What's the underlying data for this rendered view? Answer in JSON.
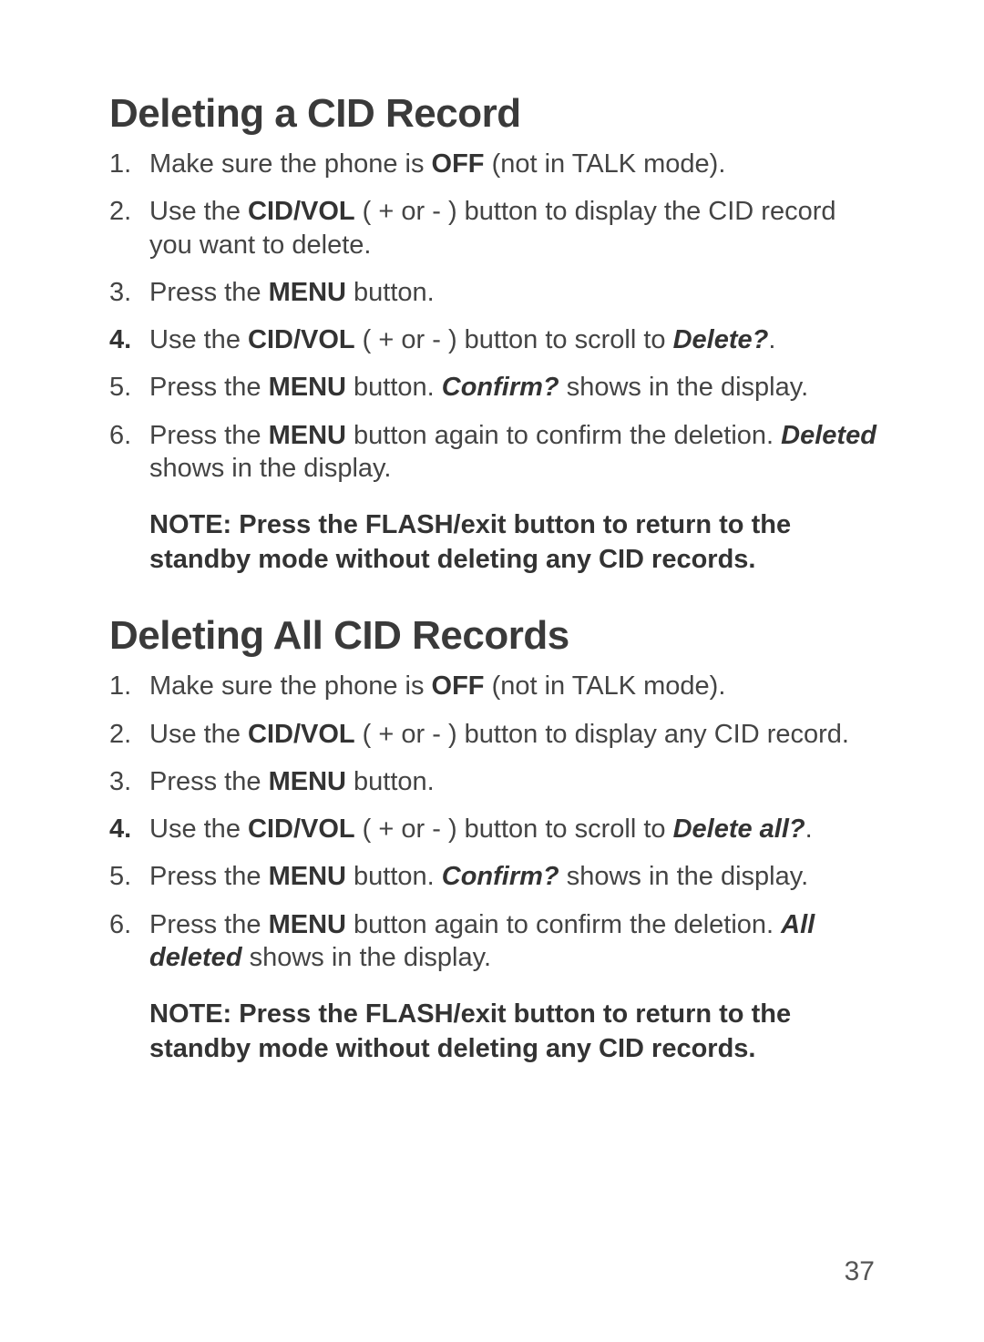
{
  "page_number": "37",
  "section1": {
    "heading": "Deleting a CID Record",
    "steps": [
      {
        "pre": "Make sure the phone is ",
        "b1": "OFF",
        "mid": " (not in TALK mode).",
        "bold_marker": false
      },
      {
        "pre": "Use the ",
        "b1": "CID/VOL",
        "mid": " ( + or - ) button to display the CID record you want to delete.",
        "bold_marker": false
      },
      {
        "pre": "Press the ",
        "b1": "MENU",
        "mid": " button.",
        "bold_marker": false
      },
      {
        "pre": "Use the ",
        "b1": "CID/VOL",
        "mid": " ( + or - ) button to scroll to ",
        "bi1": "Delete?",
        "post": ".",
        "bold_marker": true
      },
      {
        "pre": "Press the ",
        "b1": "MENU",
        "mid": " button. ",
        "bi1": "Confirm?",
        "post": " shows in the display.",
        "bold_marker": false
      },
      {
        "pre": "Press the ",
        "b1": "MENU",
        "mid": " button again to confirm the deletion. ",
        "bi1": "Deleted",
        "post": " shows in the display.",
        "bold_marker": false
      }
    ],
    "note": "NOTE: Press the FLASH/exit button to return to the standby mode without deleting any CID records."
  },
  "section2": {
    "heading": "Deleting All CID Records",
    "steps": [
      {
        "pre": "Make sure the phone is ",
        "b1": "OFF",
        "mid": " (not in TALK mode).",
        "bold_marker": false
      },
      {
        "pre": "Use the ",
        "b1": "CID/VOL",
        "mid": " ( + or - ) button to display any CID record.",
        "bold_marker": false
      },
      {
        "pre": "Press the ",
        "b1": "MENU",
        "mid": " button.",
        "bold_marker": false
      },
      {
        "pre": "Use the ",
        "b1": "CID/VOL",
        "mid": " ( + or - ) button to scroll to ",
        "bi1": "Delete all?",
        "post": ".",
        "bold_marker": true
      },
      {
        "pre": "Press the ",
        "b1": "MENU",
        "mid": " button. ",
        "bi1": "Confirm?",
        "post": " shows in the display.",
        "bold_marker": false
      },
      {
        "pre": "Press the ",
        "b1": "MENU",
        "mid": " button again to confirm the deletion. ",
        "bi1": "All deleted",
        "post": " shows in the display.",
        "bold_marker": false
      }
    ],
    "note": "NOTE: Press the FLASH/exit button to return to the standby mode without deleting any CID records."
  }
}
